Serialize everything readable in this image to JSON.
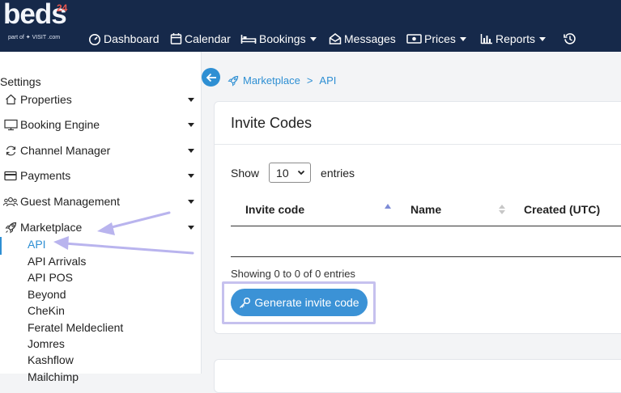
{
  "logo": {
    "word": "beds",
    "number": "24",
    "sub": "part of ✦ VISIT .com"
  },
  "nav": {
    "dashboard": "Dashboard",
    "calendar": "Calendar",
    "bookings": "Bookings",
    "messages": "Messages",
    "prices": "Prices",
    "reports": "Reports"
  },
  "sidebar": {
    "title": "Settings",
    "items": [
      {
        "label": "Properties",
        "icon": "home-icon"
      },
      {
        "label": "Booking Engine",
        "icon": "monitor-icon"
      },
      {
        "label": "Channel Manager",
        "icon": "sync-icon"
      },
      {
        "label": "Payments",
        "icon": "credit-card-icon"
      },
      {
        "label": "Guest Management",
        "icon": "users-icon"
      },
      {
        "label": "Marketplace",
        "icon": "rocket-icon"
      }
    ],
    "sub_items": [
      "API",
      "API Arrivals",
      "API POS",
      "Beyond",
      "CheKin",
      "Feratel Meldeclient",
      "Jomres",
      "Kashflow",
      "Mailchimp"
    ]
  },
  "breadcrumb": {
    "parent": "Marketplace",
    "separator": ">",
    "current": "API"
  },
  "card": {
    "title": "Invite Codes",
    "show_label": "Show",
    "entries_value": "10",
    "entries_label": "entries",
    "columns": [
      "Invite code",
      "Name",
      "Created (UTC)"
    ],
    "info": "Showing 0 to 0 of 0 entries",
    "button": "Generate invite code"
  },
  "colors": {
    "nav_bg": "#16294a",
    "accent": "#2e8fd3",
    "button": "#3b92d6",
    "annotation": "#b9b4ee"
  }
}
